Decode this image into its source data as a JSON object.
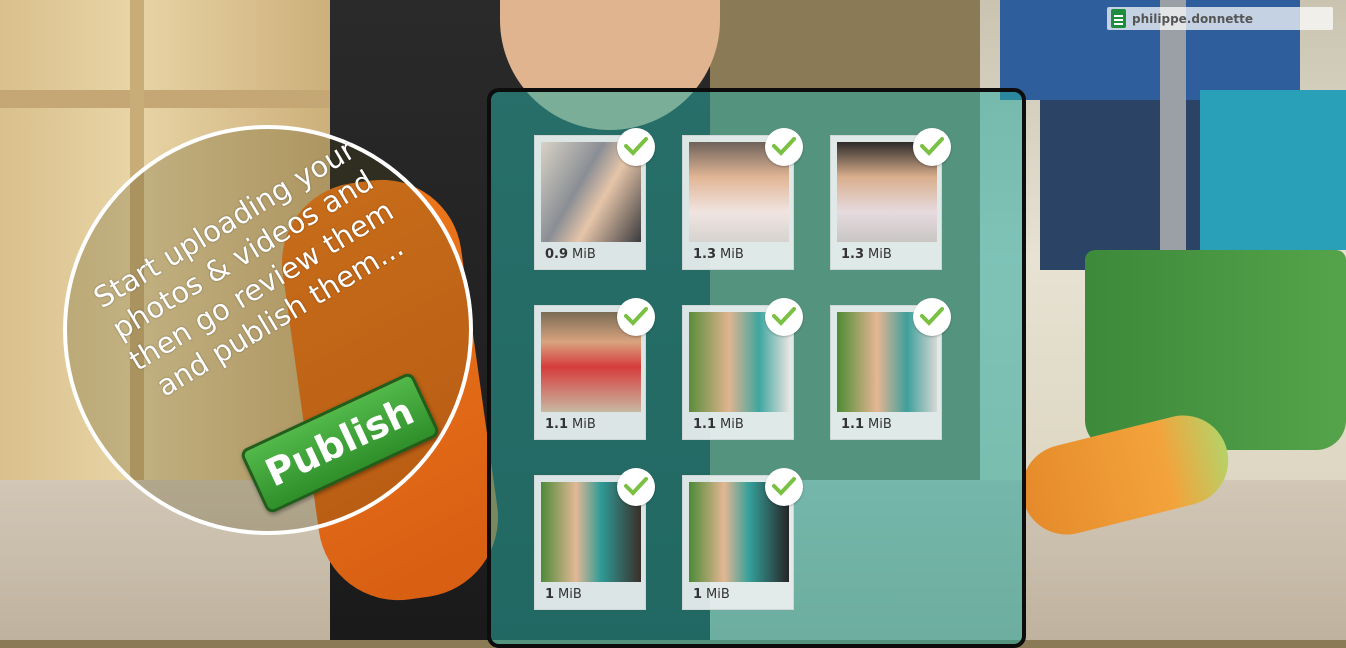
{
  "account": {
    "name": "philippe.donnette",
    "icon": "spreadsheet-icon"
  },
  "prompt": {
    "text": "Start uploading your photos & videos and then go review them and publish them...",
    "publish_label": "Publish"
  },
  "colors": {
    "panel_tint": "#28aaa0",
    "publish_green": "#3fa83a",
    "check_green": "#7ac143"
  },
  "uploads": [
    {
      "size_value": "0.9",
      "unit": "MiB",
      "status": "uploaded"
    },
    {
      "size_value": "1.3",
      "unit": "MiB",
      "status": "uploaded"
    },
    {
      "size_value": "1.3",
      "unit": "MiB",
      "status": "uploaded"
    },
    {
      "size_value": "1.1",
      "unit": "MiB",
      "status": "uploaded"
    },
    {
      "size_value": "1.1",
      "unit": "MiB",
      "status": "uploaded"
    },
    {
      "size_value": "1.1",
      "unit": "MiB",
      "status": "uploaded"
    },
    {
      "size_value": "1",
      "unit": "MiB",
      "status": "uploaded"
    },
    {
      "size_value": "1",
      "unit": "MiB",
      "status": "uploaded"
    }
  ]
}
